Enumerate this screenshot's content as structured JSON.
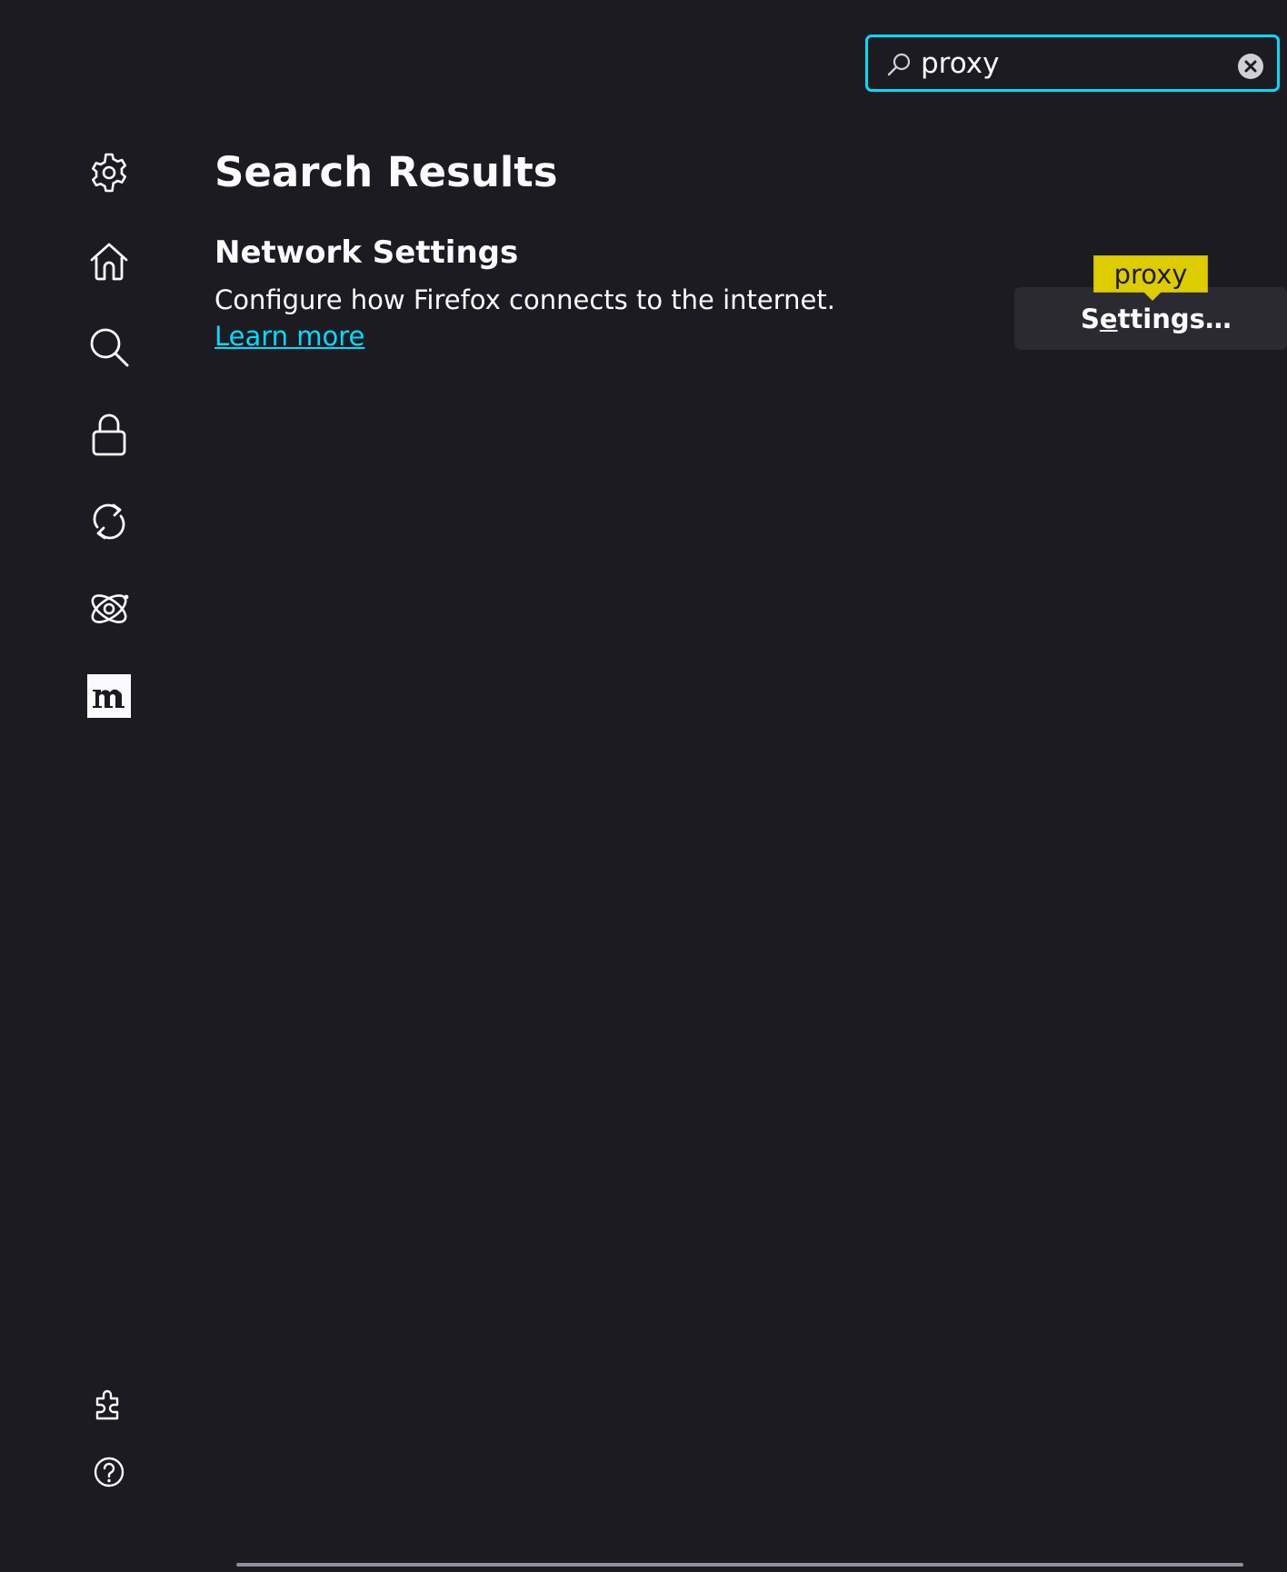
{
  "search": {
    "value": "proxy",
    "icon": "search-icon",
    "clear_icon": "clear-icon"
  },
  "sidebar": {
    "items": [
      {
        "name": "general",
        "icon": "gear-icon"
      },
      {
        "name": "home",
        "icon": "home-icon"
      },
      {
        "name": "search",
        "icon": "search-icon"
      },
      {
        "name": "privacy",
        "icon": "lock-icon"
      },
      {
        "name": "sync",
        "icon": "sync-icon"
      },
      {
        "name": "experimental",
        "icon": "atom-icon"
      },
      {
        "name": "more-from-mozilla",
        "icon": "mozilla-m-icon"
      }
    ],
    "bottom_items": [
      {
        "name": "extensions-themes",
        "icon": "puzzle-icon"
      },
      {
        "name": "support",
        "icon": "help-icon"
      }
    ]
  },
  "main": {
    "title": "Search Results",
    "section": {
      "title": "Network Settings",
      "description": "Configure how Firefox connects to the internet.",
      "learn_more": "Learn more",
      "button_pre": "S",
      "button_accel": "e",
      "button_post": "ttings…"
    },
    "tooltip": "proxy"
  },
  "colors": {
    "background": "#1c1b22",
    "accent": "#00ddff",
    "tooltip": "#ddcc00",
    "button": "#2b2a33"
  }
}
